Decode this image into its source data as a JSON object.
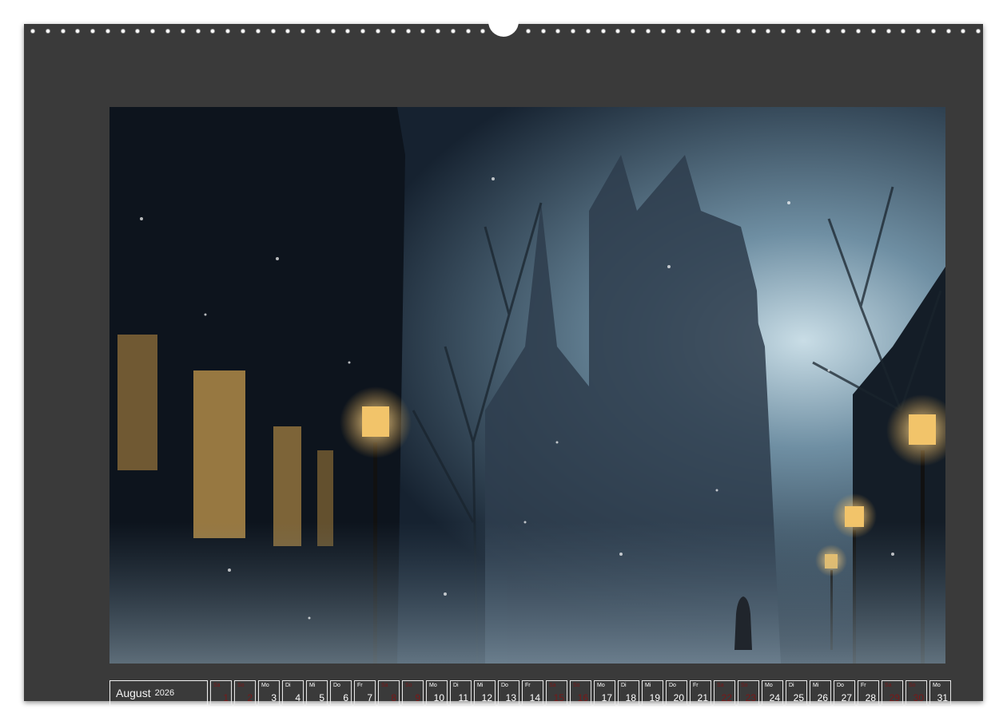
{
  "calendar": {
    "month": "August",
    "year": "2026",
    "days": [
      {
        "wd": "Sa",
        "day": "1",
        "weekend": true
      },
      {
        "wd": "So",
        "day": "2",
        "weekend": true
      },
      {
        "wd": "Mo",
        "day": "3",
        "weekend": false
      },
      {
        "wd": "Di",
        "day": "4",
        "weekend": false
      },
      {
        "wd": "Mi",
        "day": "5",
        "weekend": false
      },
      {
        "wd": "Do",
        "day": "6",
        "weekend": false
      },
      {
        "wd": "Fr",
        "day": "7",
        "weekend": false
      },
      {
        "wd": "Sa",
        "day": "8",
        "weekend": true
      },
      {
        "wd": "So",
        "day": "9",
        "weekend": true
      },
      {
        "wd": "Mo",
        "day": "10",
        "weekend": false
      },
      {
        "wd": "Di",
        "day": "11",
        "weekend": false
      },
      {
        "wd": "Mi",
        "day": "12",
        "weekend": false
      },
      {
        "wd": "Do",
        "day": "13",
        "weekend": false
      },
      {
        "wd": "Fr",
        "day": "14",
        "weekend": false
      },
      {
        "wd": "Sa",
        "day": "15",
        "weekend": true
      },
      {
        "wd": "So",
        "day": "16",
        "weekend": true
      },
      {
        "wd": "Mo",
        "day": "17",
        "weekend": false
      },
      {
        "wd": "Di",
        "day": "18",
        "weekend": false
      },
      {
        "wd": "Mi",
        "day": "19",
        "weekend": false
      },
      {
        "wd": "Do",
        "day": "20",
        "weekend": false
      },
      {
        "wd": "Fr",
        "day": "21",
        "weekend": false
      },
      {
        "wd": "Sa",
        "day": "22",
        "weekend": true
      },
      {
        "wd": "So",
        "day": "23",
        "weekend": true
      },
      {
        "wd": "Mo",
        "day": "24",
        "weekend": false
      },
      {
        "wd": "Di",
        "day": "25",
        "weekend": false
      },
      {
        "wd": "Mi",
        "day": "26",
        "weekend": false
      },
      {
        "wd": "Do",
        "day": "27",
        "weekend": false
      },
      {
        "wd": "Fr",
        "day": "28",
        "weekend": false
      },
      {
        "wd": "Sa",
        "day": "29",
        "weekend": true
      },
      {
        "wd": "So",
        "day": "30",
        "weekend": true
      },
      {
        "wd": "Mo",
        "day": "31",
        "weekend": false
      }
    ]
  },
  "colors": {
    "frame": "#3a3a3a",
    "weekday_text": "#ffffff",
    "weekend_text": "#7a1818",
    "lamp_glow": "#f2c46a"
  }
}
